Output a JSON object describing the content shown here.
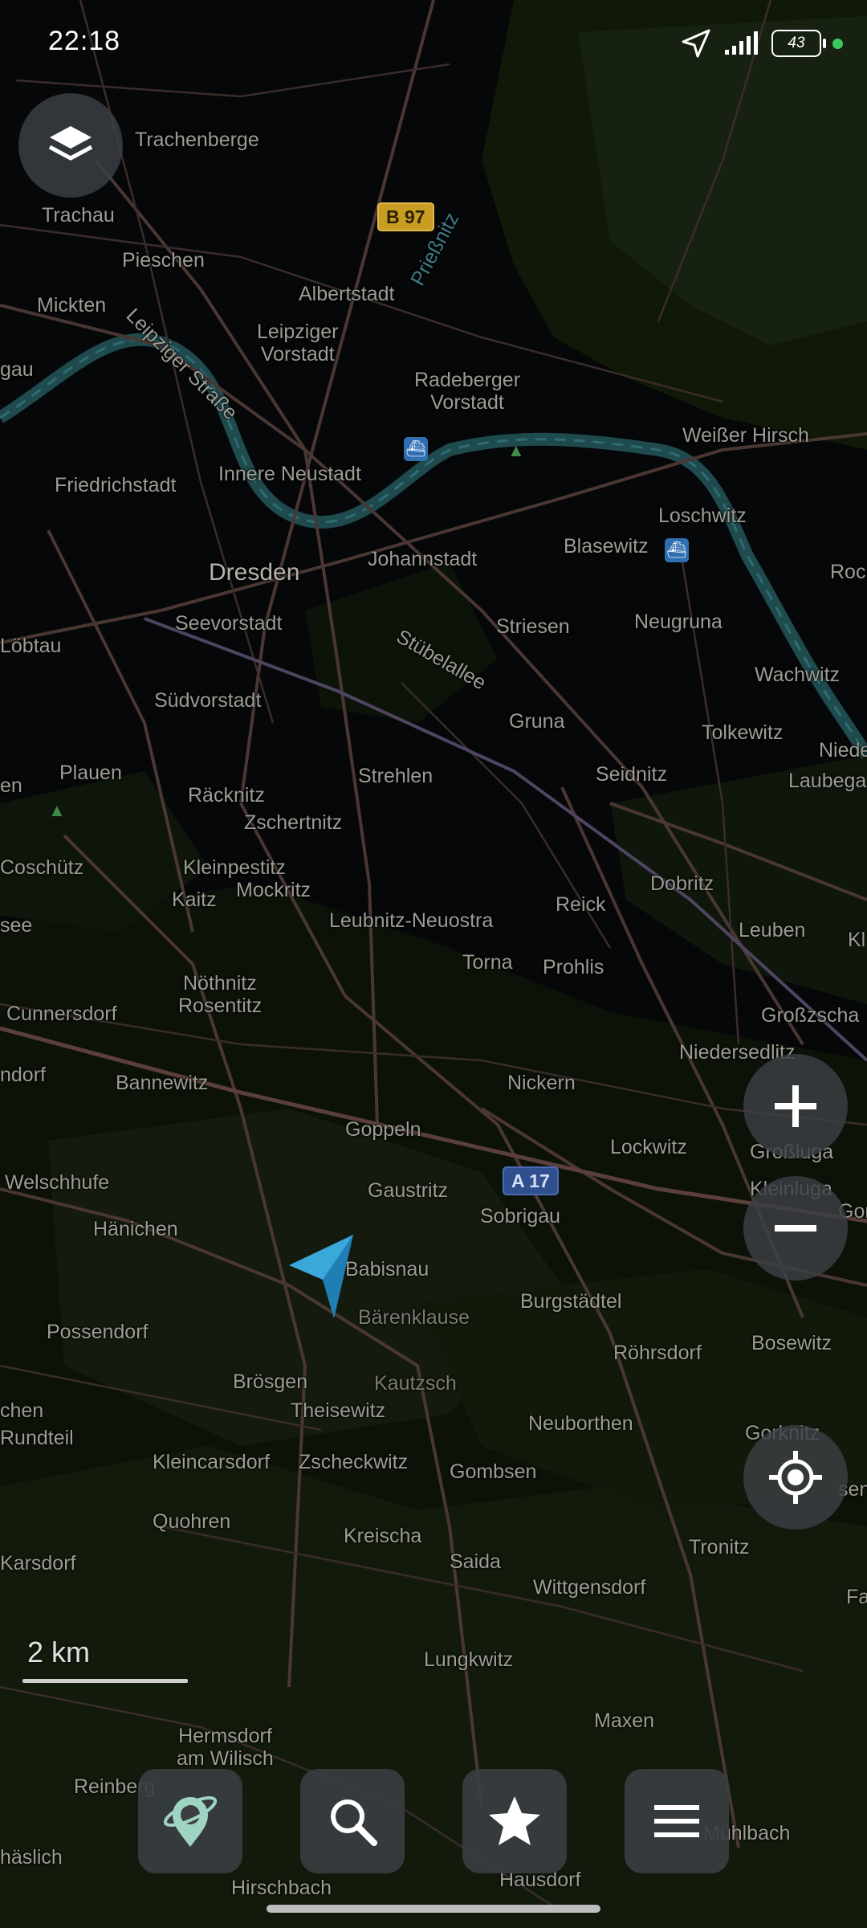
{
  "status_bar": {
    "time": "22:18",
    "battery": "43",
    "icons": [
      "location-arrow-icon",
      "signal-icon",
      "battery-icon",
      "active-dot-icon"
    ]
  },
  "map": {
    "city_label": "Dresden",
    "labels": {
      "trachenberge": "Trachenberge",
      "trachau": "Trachau",
      "pieschen": "Pieschen",
      "mickten": "Mickten",
      "gau": "gau",
      "albertstadt": "Albertstadt",
      "priessnitz": "Prießnitz",
      "leipziger_vorstadt_1": "Leipziger",
      "leipziger_vorstadt_2": "Vorstadt",
      "leipziger_strasse": "Leipziger Straße",
      "radeberger_1": "Radeberger",
      "radeberger_2": "Vorstadt",
      "weisser_hirsch": "Weißer Hirsch",
      "friedrichstadt": "Friedrichstadt",
      "innere_neustadt": "Innere Neustadt",
      "loschwitz": "Loschwitz",
      "blasewitz": "Blasewitz",
      "roc": "Roc",
      "johannstadt": "Johannstadt",
      "seevorstadt": "Seevorstadt",
      "striesen": "Striesen",
      "neugruna": "Neugruna",
      "lobtau": "Löbtau",
      "stuebelallee": "Stübelallee",
      "wachwitz": "Wachwitz",
      "suedvorstadt": "Südvorstadt",
      "gruna": "Gruna",
      "tolkewitz": "Tolkewitz",
      "niede": "Niede",
      "plauen": "Plauen",
      "en": "en",
      "strehlen": "Strehlen",
      "seidnitz": "Seidnitz",
      "laubega": "Laubega",
      "raecknitz": "Räcknitz",
      "zschertnitz": "Zschertnitz",
      "coschutz": "Coschütz",
      "kleinpestitz": "Kleinpestitz",
      "mockritz": "Mockritz",
      "kaitz": "Kaitz",
      "dobritz": "Dobritz",
      "see": "see",
      "leubnitz": "Leubnitz-Neuostra",
      "reick": "Reick",
      "leuben": "Leuben",
      "kl": "Kl",
      "torna": "Torna",
      "prohlis": "Prohlis",
      "noethnitz": "Nöthnitz",
      "rosentitz": "Rosentitz",
      "cunnersdorf": "Cunnersdorf",
      "grossschachwitz": "Großzscha",
      "niedersedlitz": "Niedersedlitz",
      "ndorf": "ndorf",
      "bannewitz": "Bannewitz",
      "nickern": "Nickern",
      "goppeln": "Goppeln",
      "lockwitz": "Lockwitz",
      "grossluga": "Großluga",
      "welschhufe": "Welschhufe",
      "gaustritz": "Gaustritz",
      "kleinluga": "Kleinluga",
      "gom": "Gom",
      "haenichen": "Hänichen",
      "sobrigau": "Sobrigau",
      "babisnau": "Babisnau",
      "burgstaedtel": "Burgstädtel",
      "baerenklause": "Bärenklause",
      "possendorf": "Possendorf",
      "roehrsdorf": "Röhrsdorf",
      "bosewitz": "Bosewitz",
      "broesgen": "Brösgen",
      "kautzsch": "Kautzsch",
      "chen": "chen",
      "theisewitz": "Theisewitz",
      "neuborthen": "Neuborthen",
      "rundteil": "Rundteil",
      "gorknitz": "Gorknitz",
      "kleincarsdorf": "Kleincarsdorf",
      "zscheckwitz": "Zscheckwitz",
      "gombsen": "Gombsen",
      "sen": "sen",
      "quohren": "Quohren",
      "kreischa": "Kreischa",
      "tronitz": "Tronitz",
      "karsdorf": "Karsdorf",
      "saida": "Saida",
      "wittgensdorf": "Wittgensdorf",
      "fa": "Fa",
      "lungkwitz": "Lungkwitz",
      "maxen": "Maxen",
      "hermsdorf_1": "Hermsdorf",
      "hermsdorf_2": "am Wilisch",
      "reinberg": "Reinberg",
      "haeslich": "häslich",
      "muehlbach": "Mühlbach",
      "hausdorf": "Hausdorf",
      "hirschbach": "Hirschbach"
    },
    "road_shields": {
      "b97": "B 97",
      "a17": "A 17"
    },
    "colors": {
      "background": "#060708",
      "forest": "#1a2212",
      "field": "#0e1209",
      "road": "#4a3733",
      "river": "#1f4a4e"
    }
  },
  "controls": {
    "layers_button_icon": "layers-icon",
    "zoom_in_icon": "plus-icon",
    "zoom_out_icon": "minus-icon",
    "locate_icon": "my-location-icon",
    "position_marker_icon": "navigation-arrow-icon"
  },
  "scale": {
    "label": "2 km"
  },
  "bottom_bar": {
    "buttons": [
      {
        "icon": "discover-globe-pin-icon"
      },
      {
        "icon": "search-icon"
      },
      {
        "icon": "star-icon"
      },
      {
        "icon": "menu-icon"
      }
    ]
  }
}
